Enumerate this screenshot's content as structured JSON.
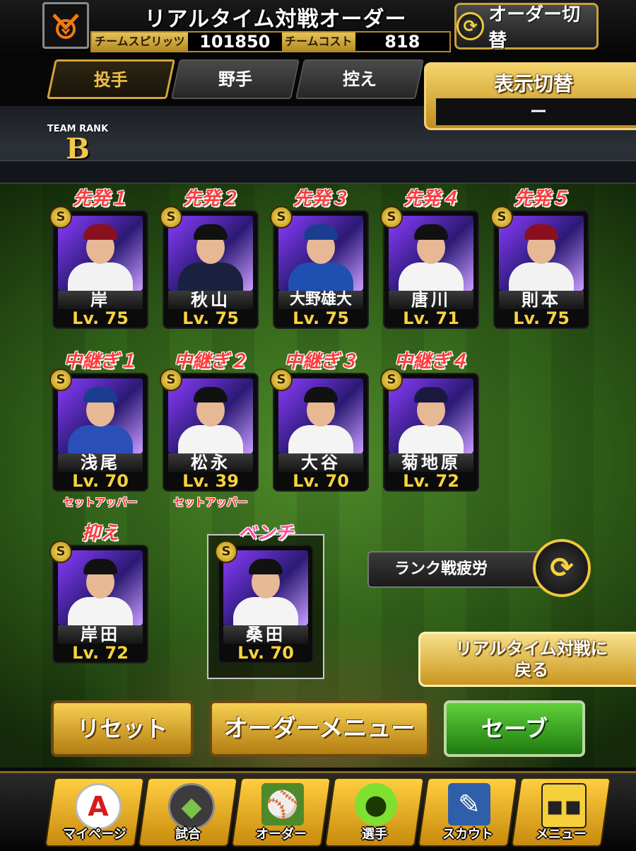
{
  "header": {
    "title": "リアルタイム対戦オーダー",
    "team_spirits_label": "チームスピリッツ",
    "team_spirits_value": "101850",
    "team_cost_label": "チームコスト",
    "team_cost_value": "818",
    "order_switch_label": "オーダー切替"
  },
  "tabs": [
    {
      "label": "投手",
      "active": true
    },
    {
      "label": "野手",
      "active": false
    },
    {
      "label": "控え",
      "active": false
    }
  ],
  "display_toggle": {
    "title": "表示切替",
    "value": "ー"
  },
  "team_rank": {
    "caption": "TEAM RANK",
    "value": "B"
  },
  "pitchers": {
    "starters": [
      {
        "slot": "先発１",
        "name": "岸",
        "level": "Lv. 75",
        "badge": "S"
      },
      {
        "slot": "先発２",
        "name": "秋山",
        "level": "Lv. 75",
        "badge": "S"
      },
      {
        "slot": "先発３",
        "name": "大野雄大",
        "level": "Lv. 75",
        "badge": "S"
      },
      {
        "slot": "先発４",
        "name": "唐川",
        "level": "Lv. 71",
        "badge": "S"
      },
      {
        "slot": "先発５",
        "name": "則本",
        "level": "Lv. 75",
        "badge": "S"
      }
    ],
    "relievers": [
      {
        "slot": "中継ぎ１",
        "name": "浅尾",
        "level": "Lv. 70",
        "badge": "S",
        "role": "セットアッパー"
      },
      {
        "slot": "中継ぎ２",
        "name": "松永",
        "level": "Lv. 39",
        "badge": "S",
        "role": "セットアッパー"
      },
      {
        "slot": "中継ぎ３",
        "name": "大谷",
        "level": "Lv. 70",
        "badge": "S",
        "role": ""
      },
      {
        "slot": "中継ぎ４",
        "name": "菊地原",
        "level": "Lv. 72",
        "badge": "S",
        "role": ""
      }
    ],
    "closer": {
      "slot": "抑え",
      "name": "岸田",
      "level": "Lv. 72",
      "badge": "S"
    },
    "bench": {
      "slot": "ベンチ",
      "name": "桑田",
      "level": "Lv. 70",
      "badge": "S"
    }
  },
  "fatigue": {
    "label": "ランク戦疲労"
  },
  "return_button": {
    "line1": "リアルタイム対戦に",
    "line2": "戻る"
  },
  "actions": {
    "reset": "リセット",
    "order_menu": "オーダーメニュー",
    "save": "セーブ"
  },
  "bottom_nav": [
    {
      "label": "マイページ",
      "icon": "mypage-icon"
    },
    {
      "label": "試合",
      "icon": "stadium-icon"
    },
    {
      "label": "オーダー",
      "icon": "order-icon"
    },
    {
      "label": "選手",
      "icon": "player-icon"
    },
    {
      "label": "スカウト",
      "icon": "scout-icon"
    },
    {
      "label": "メニュー",
      "icon": "menu-icon"
    }
  ],
  "colors": {
    "accent_gold": "#f2c04a",
    "slot_label_red": "#ff3b3b",
    "bench_label_pink": "#ff4fa0",
    "level_yellow": "#f7d23e",
    "save_green": "#3fae22"
  }
}
